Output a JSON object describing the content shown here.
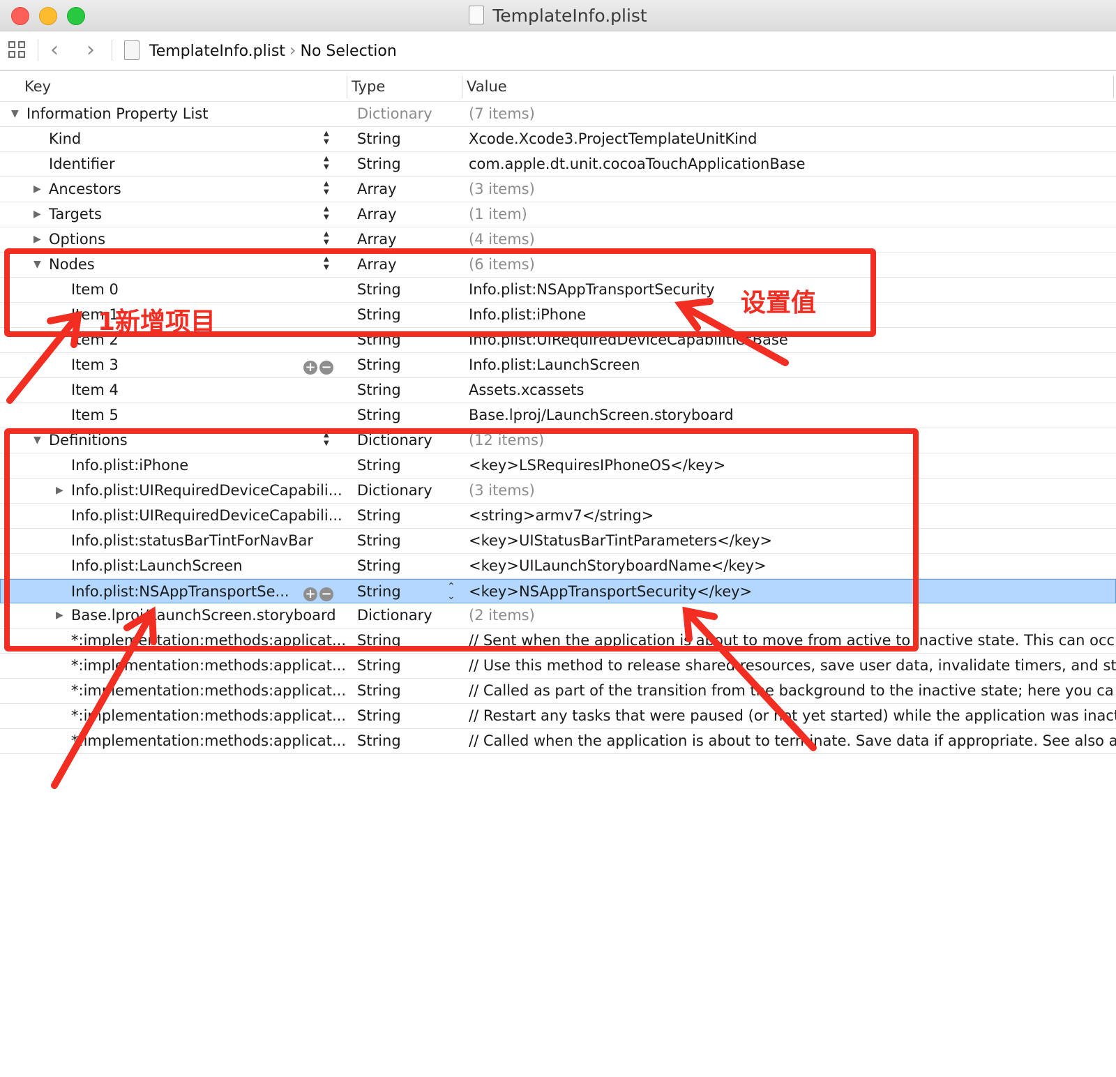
{
  "window": {
    "title": "TemplateInfo.plist"
  },
  "toolbar": {
    "file": "TemplateInfo.plist",
    "selection": "No Selection"
  },
  "columns": {
    "key": "Key",
    "type": "Type",
    "value": "Value"
  },
  "rows": [
    {
      "key": "Information Property List",
      "type": "Dictionary",
      "value": "(7 items)"
    },
    {
      "key": "Kind",
      "type": "String",
      "value": "Xcode.Xcode3.ProjectTemplateUnitKind"
    },
    {
      "key": "Identifier",
      "type": "String",
      "value": "com.apple.dt.unit.cocoaTouchApplicationBase"
    },
    {
      "key": "Ancestors",
      "type": "Array",
      "value": "(3 items)"
    },
    {
      "key": "Targets",
      "type": "Array",
      "value": "(1 item)"
    },
    {
      "key": "Options",
      "type": "Array",
      "value": "(4 items)"
    },
    {
      "key": "Nodes",
      "type": "Array",
      "value": "(6 items)"
    },
    {
      "key": "Item 0",
      "type": "String",
      "value": "Info.plist:NSAppTransportSecurity"
    },
    {
      "key": "Item 1",
      "type": "String",
      "value": "Info.plist:iPhone"
    },
    {
      "key": "Item 2",
      "type": "String",
      "value": "Info.plist:UIRequiredDeviceCapabilitiesBase"
    },
    {
      "key": "Item 3",
      "type": "String",
      "value": "Info.plist:LaunchScreen"
    },
    {
      "key": "Item 4",
      "type": "String",
      "value": "Assets.xcassets"
    },
    {
      "key": "Item 5",
      "type": "String",
      "value": "Base.lproj/LaunchScreen.storyboard"
    },
    {
      "key": "Definitions",
      "type": "Dictionary",
      "value": "(12 items)"
    },
    {
      "key": "Info.plist:iPhone",
      "type": "String",
      "value": "<key>LSRequiresIPhoneOS</key>"
    },
    {
      "key": "Info.plist:UIRequiredDeviceCapabili...",
      "type": "Dictionary",
      "value": "(3 items)"
    },
    {
      "key": "Info.plist:UIRequiredDeviceCapabili...",
      "type": "String",
      "value": "<string>armv7</string>"
    },
    {
      "key": "Info.plist:statusBarTintForNavBar",
      "type": "String",
      "value": "<key>UIStatusBarTintParameters</key>"
    },
    {
      "key": "Info.plist:LaunchScreen",
      "type": "String",
      "value": "<key>UILaunchStoryboardName</key>"
    },
    {
      "key": "Info.plist:NSAppTransportSe...",
      "type": "String",
      "value": "<key>NSAppTransportSecurity</key>"
    },
    {
      "key": "Base.lproj/LaunchScreen.storyboard",
      "type": "Dictionary",
      "value": "(2 items)"
    },
    {
      "key": "*:implementation:methods:applicat...",
      "type": "String",
      "value": "// Sent when the application is about to move from active to inactive state. This can occ"
    },
    {
      "key": "*:implementation:methods:applicat...",
      "type": "String",
      "value": "// Use this method to release shared resources, save user data, invalidate timers, and st"
    },
    {
      "key": "*:implementation:methods:applicat...",
      "type": "String",
      "value": "// Called as part of the transition from the background to the inactive state; here you ca"
    },
    {
      "key": "*:implementation:methods:applicat...",
      "type": "String",
      "value": "// Restart any tasks that were paused (or not yet started) while the application was inact"
    },
    {
      "key": "*:implementation:methods:applicat...",
      "type": "String",
      "value": "// Called when the application is about to terminate. Save data if appropriate. See also a"
    }
  ],
  "annotations": {
    "add_item": "1新增项目",
    "set_value": "设置值"
  },
  "colors": {
    "annotation": "#f22d22",
    "selection": "#b3d7ff"
  }
}
